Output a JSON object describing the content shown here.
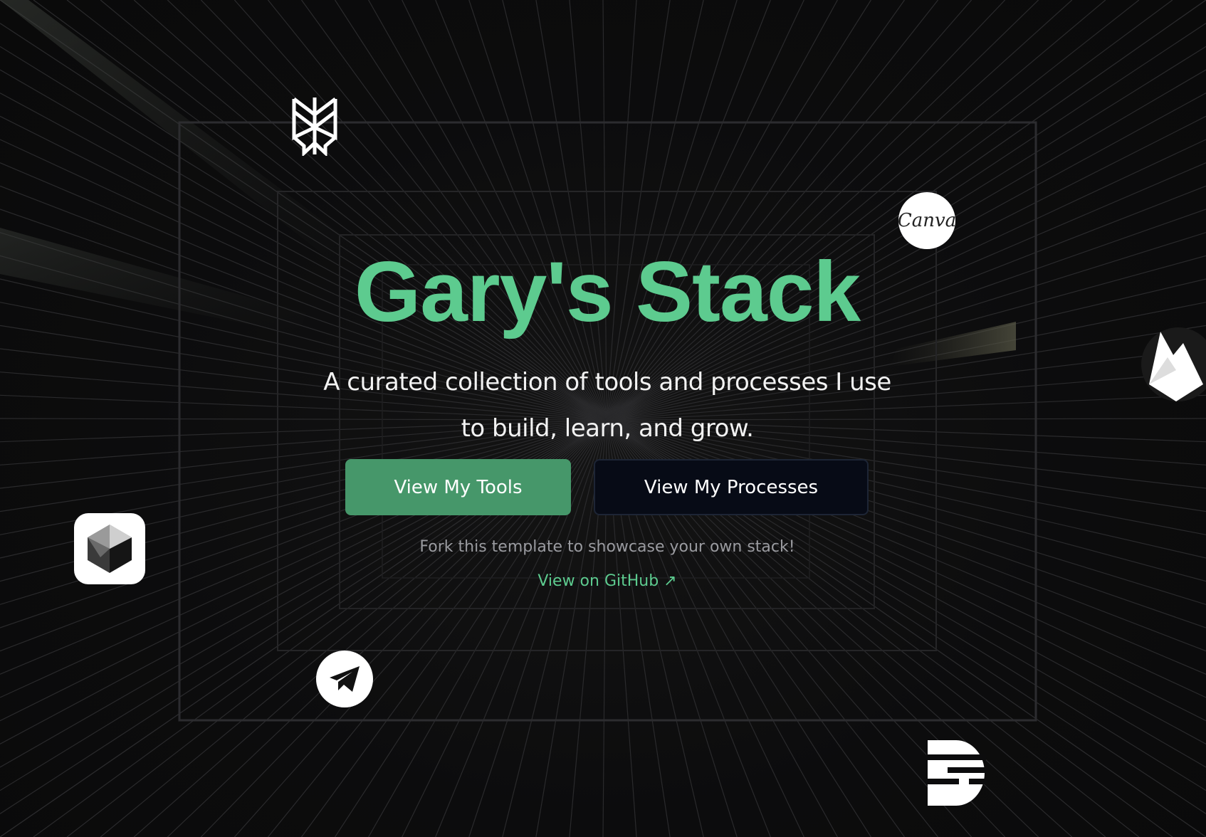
{
  "hero": {
    "title": "Gary's Stack",
    "subtitle": "A curated collection of tools and processes I use to build, learn, and grow.",
    "title_color": "#5dcb8f"
  },
  "buttons": {
    "tools_label": "View My Tools",
    "processes_label": "View My Processes",
    "tools_color": "#46976a",
    "processes_color": "#070b16"
  },
  "footer": {
    "fork_text": "Fork this template to showcase your own stack!",
    "github_link": "View on GitHub ↗"
  },
  "floating_icons": {
    "canva_label": "Canva",
    "icons": [
      "perplexity-icon",
      "canva-icon",
      "firebase-icon",
      "cube-icon",
      "telegram-icon",
      "strapi-icon"
    ]
  }
}
